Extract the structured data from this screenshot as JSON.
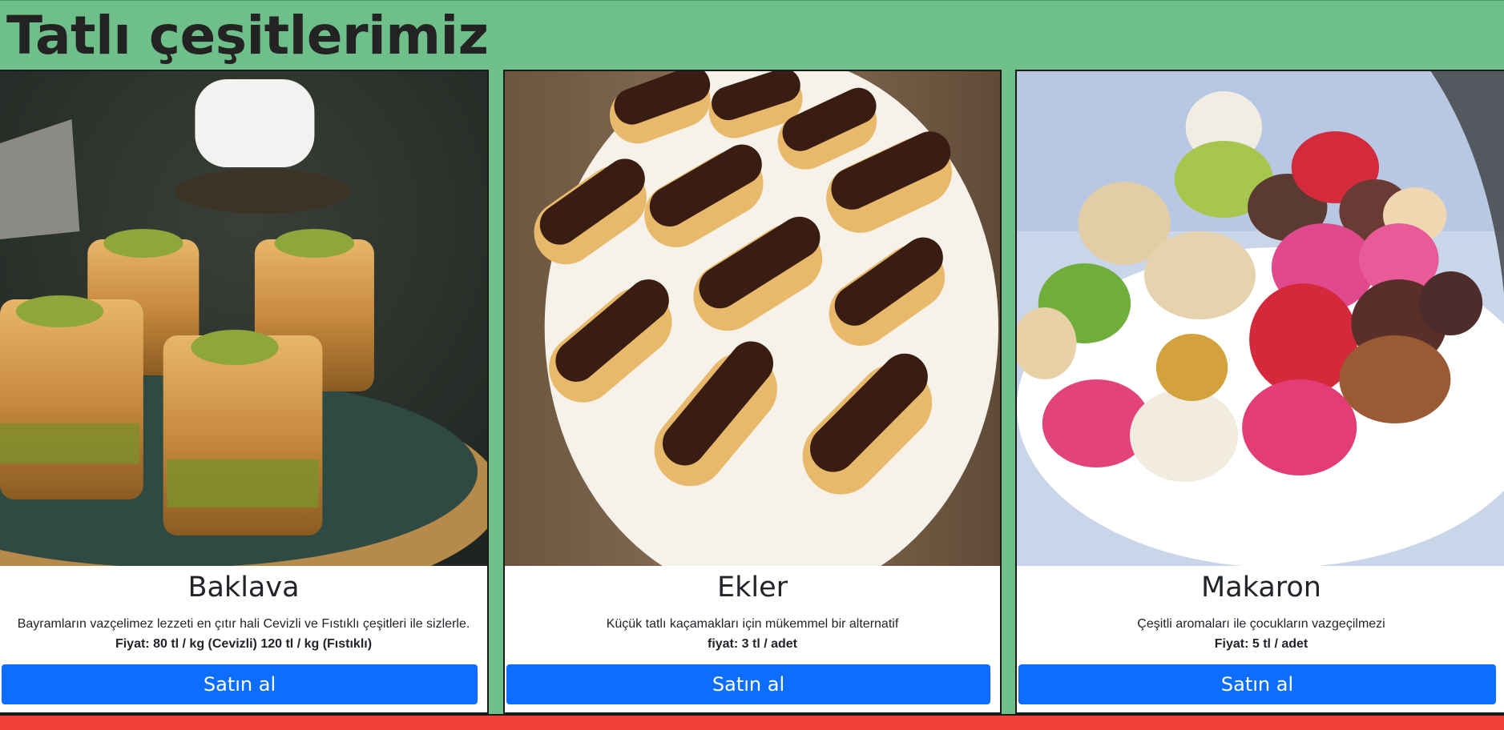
{
  "header": {
    "title": "Tatlı çeşitlerimiz"
  },
  "cards": [
    {
      "name": "Baklava",
      "description": "Bayramların vazçelimez lezzeti en çıtır hali Cevizli ve Fıstıklı çeşitleri ile sizlerle.",
      "price": "Fiyat: 80 tl / kg (Cevizli) 120 tl / kg (Fıstıklı)",
      "button_label": "Satın al",
      "image": "baklava-photo"
    },
    {
      "name": "Ekler",
      "description": "Küçük tatlı kaçamakları için mükemmel bir alternatif",
      "price": "fiyat: 3 tl / adet",
      "button_label": "Satın al",
      "image": "ekler-photo"
    },
    {
      "name": "Makaron",
      "description": "Çeşitli aromaları ile çocukların vazgeçilmezi",
      "price": "Fiyat: 5 tl / adet",
      "button_label": "Satın al",
      "image": "makaron-photo"
    }
  ],
  "colors": {
    "header_bg": "#6fbf8b",
    "button_bg": "#0d6efd",
    "bottom_bg": "#f0403a"
  }
}
